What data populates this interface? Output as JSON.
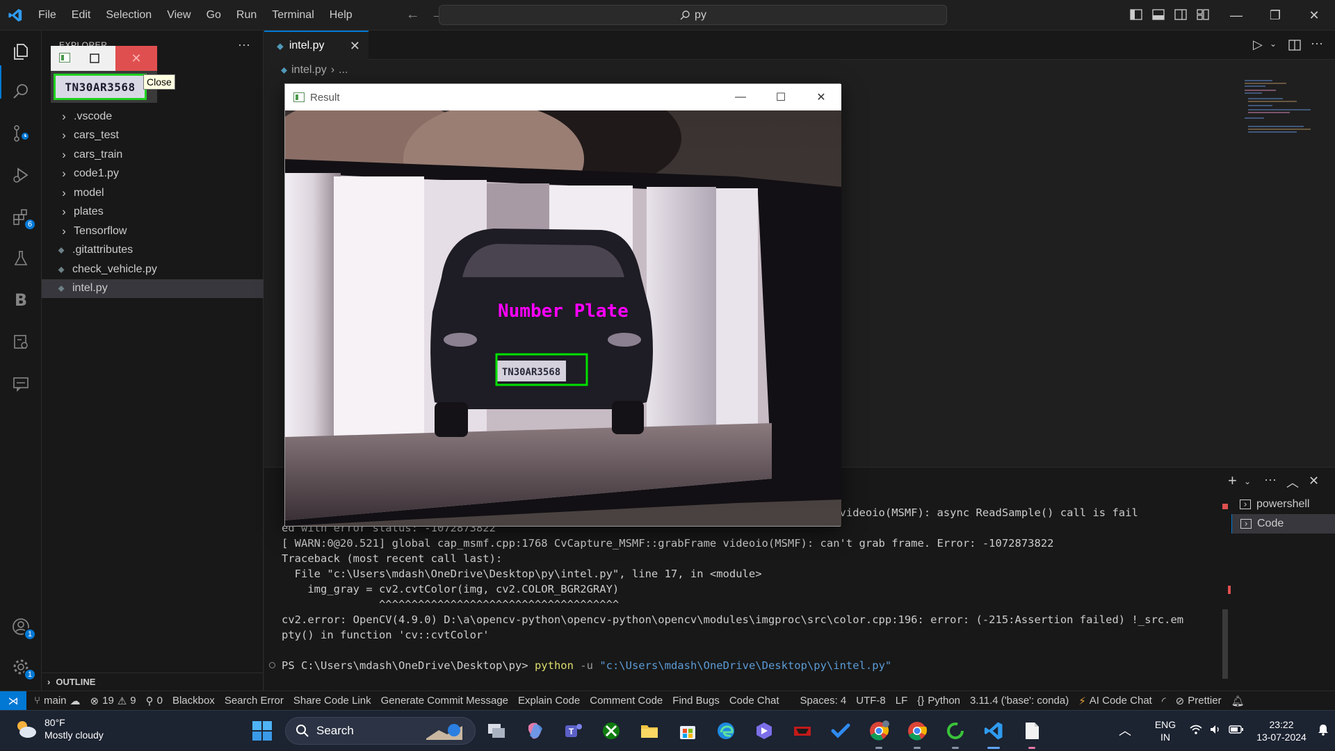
{
  "window": {
    "menu": [
      "File",
      "Edit",
      "Selection",
      "View",
      "Go",
      "Run",
      "Terminal",
      "Help"
    ],
    "search_text": "py"
  },
  "activity": {
    "extensions_badge": "6",
    "accounts_badge": "1",
    "settings_badge": "1"
  },
  "explorer": {
    "title": "EXPLORER",
    "more": "···",
    "items": [
      {
        "label": ".vscode",
        "type": "folder"
      },
      {
        "label": "cars_test",
        "type": "folder"
      },
      {
        "label": "cars_train",
        "type": "folder"
      },
      {
        "label": "code1.py",
        "type": "folder"
      },
      {
        "label": "model",
        "type": "folder"
      },
      {
        "label": "plates",
        "type": "folder"
      },
      {
        "label": "Tensorflow",
        "type": "folder"
      },
      {
        "label": ".gitattributes",
        "type": "file"
      },
      {
        "label": "check_vehicle.py",
        "type": "file"
      },
      {
        "label": "intel.py",
        "type": "file",
        "selected": true
      }
    ],
    "outline_label": "OUTLINE"
  },
  "mini_window": {
    "plate_text": "TN30AR3568",
    "tooltip": "Close"
  },
  "editor": {
    "tab_label": "intel.py",
    "breadcrumb_file": "intel.py",
    "breadcrumb_rest": "..."
  },
  "result_window": {
    "title": "Result",
    "annotation": "Number Plate",
    "plate_text": "TN30AR3568"
  },
  "terminal": {
    "lines": [
      "                                                                                  ple videoio(MSMF): async ReadSample() call is fail",
      "ed with error status: -1072873822",
      "[ WARN:0@20.521] global cap_msmf.cpp:1768 CvCapture_MSMF::grabFrame videoio(MSMF): can't grab frame. Error: -1072873822",
      "Traceback (most recent call last):",
      "  File \"c:\\Users\\mdash\\OneDrive\\Desktop\\py\\intel.py\", line 17, in <module>",
      "    img_gray = cv2.cvtColor(img, cv2.COLOR_BGR2GRAY)",
      "               ^^^^^^^^^^^^^^^^^^^^^^^^^^^^^^^^^^^^^",
      "cv2.error: OpenCV(4.9.0) D:\\a\\opencv-python\\opencv-python\\opencv\\modules\\imgproc\\src\\color.cpp:196: error: (-215:Assertion failed) !_src.em",
      "pty() in function 'cv::cvtColor'"
    ],
    "prompt": "PS C:\\Users\\mdash\\OneDrive\\Desktop\\py>",
    "command": "python",
    "flag": "-u",
    "path_arg": "\"c:\\Users\\mdash\\OneDrive\\Desktop\\py\\intel.py\"",
    "shells": [
      "powershell",
      "Code"
    ]
  },
  "statusbar": {
    "branch": "main",
    "errors": "19",
    "warnings": "9",
    "ports": "0",
    "items": [
      "Blackbox",
      "Search Error",
      "Share Code Link",
      "Generate Commit Message",
      "Explain Code",
      "Comment Code",
      "Find Bugs",
      "Code Chat"
    ],
    "spaces": "Spaces: 4",
    "encoding": "UTF-8",
    "eol": "LF",
    "language": "Python",
    "interpreter": "3.11.4 ('base': conda)",
    "ai_chat": "AI Code Chat",
    "prettier": "Prettier"
  },
  "taskbar": {
    "temp": "80°F",
    "weather": "Mostly cloudy",
    "search_label": "Search",
    "lang1": "ENG",
    "lang2": "IN",
    "time": "23:22",
    "date": "13-07-2024"
  },
  "colors": {
    "accent": "#0078d4",
    "annotation": "#ff00ff",
    "box": "#00e000"
  }
}
